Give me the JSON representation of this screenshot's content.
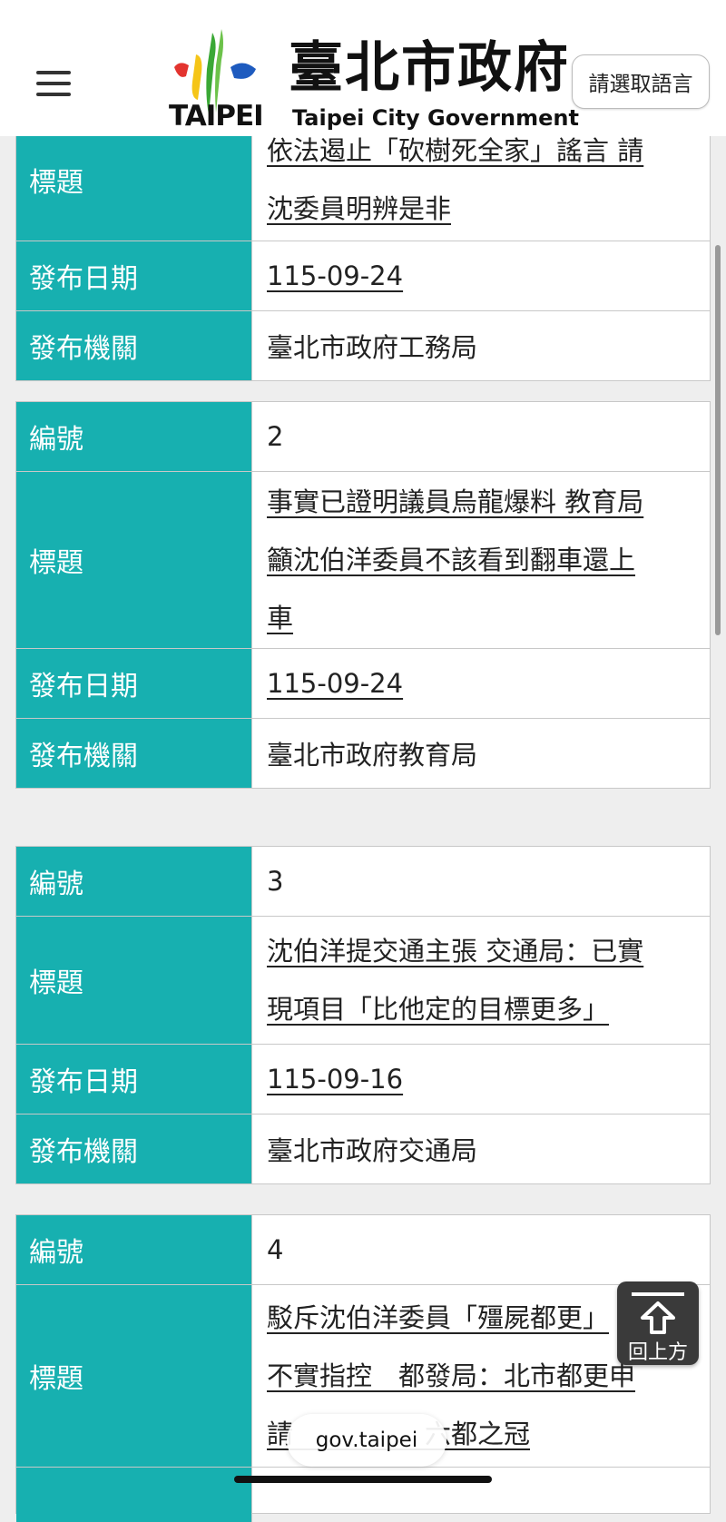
{
  "header": {
    "menu_icon": "hamburger-menu-icon",
    "logo_word": "TAIPEI",
    "title_zh": "臺北市政府",
    "title_en": "Taipei City Government",
    "language_button": "請選取語言"
  },
  "labels": {
    "number": "編號",
    "title": "標題",
    "date": "發布日期",
    "agency": "發布機關"
  },
  "records": [
    {
      "title_lines": [
        "依法遏止「砍樹死全家」謠言 請",
        "沈委員明辨是非"
      ],
      "date": "115-09-24",
      "agency": "臺北市政府工務局"
    },
    {
      "number": "2",
      "title_lines": [
        "事實已證明議員烏龍爆料 教育局",
        "籲沈伯洋委員不該看到翻車還上",
        "車"
      ],
      "date": "115-09-24",
      "agency": "臺北市政府教育局"
    },
    {
      "number": "3",
      "title_lines": [
        "沈伯洋提交通主張 交通局：已實",
        "現項目「比他定的目標更多」"
      ],
      "date": "115-09-16",
      "agency": "臺北市政府交通局"
    },
    {
      "number": "4",
      "title_lines": [
        "駁斥沈伯洋委員「殭屍都更」",
        "不實指控　都發局：北市都更申",
        "請　　　　　六都之冠"
      ]
    }
  ],
  "back_to_top": {
    "label": "回上方",
    "icon": "arrow-up-icon"
  },
  "browser": {
    "url": "gov.taipei"
  },
  "colors": {
    "label_bg": "#17b0b0",
    "label_text": "#ffffff"
  }
}
